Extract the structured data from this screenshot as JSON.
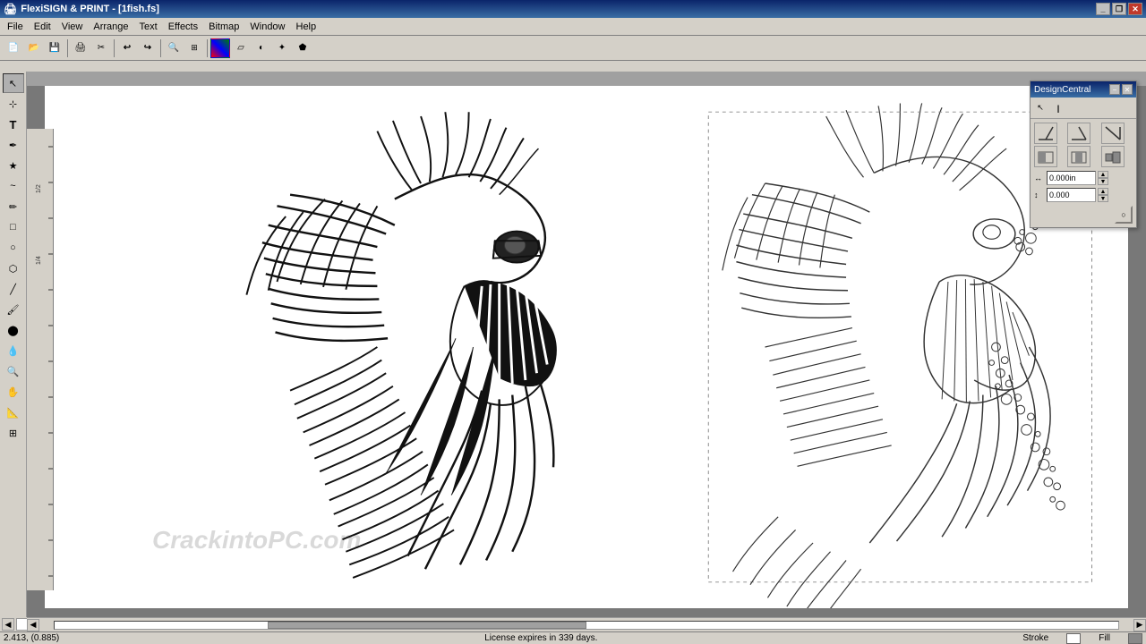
{
  "title_bar": {
    "title": "FlexiSIGN & PRINT - [1fish.fs]",
    "minimize_label": "_",
    "maximize_label": "□",
    "close_label": "✕",
    "restore_label": "❐"
  },
  "menu": {
    "items": [
      "File",
      "Edit",
      "View",
      "Arrange",
      "Text",
      "Effects",
      "Bitmap",
      "Window",
      "Help"
    ]
  },
  "design_central": {
    "title": "DesignCentral",
    "minimize_label": "−",
    "close_label": "✕",
    "tools": [
      "↖",
      "↗"
    ],
    "icons": [
      "◤",
      "⌐",
      "◫",
      "⌐",
      "◥",
      "⌐"
    ],
    "field1_label": "↔",
    "field1_value": "0.000in",
    "field2_label": "↕",
    "field2_value": "0.000"
  },
  "status_bar": {
    "coordinates": "2.413, (0.885)",
    "license": "License expires in 339 days.",
    "stroke_label": "Stroke",
    "fill_label": "Fill"
  },
  "watermark": "CrackintoPC.com",
  "colors": {
    "bg": "#a0a0a0",
    "canvas": "#ffffff",
    "titlebar_start": "#0a246a",
    "titlebar_end": "#3a6ea5"
  }
}
